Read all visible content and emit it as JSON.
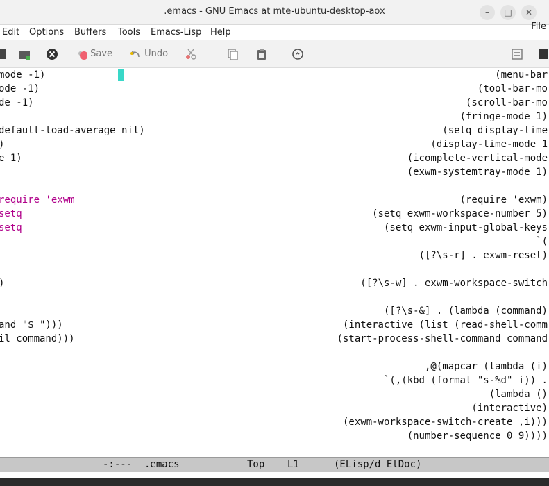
{
  "window": {
    "title": ".emacs - GNU Emacs at mte-ubuntu-desktop-aox",
    "controls": [
      "–",
      "□",
      "✕"
    ]
  },
  "menu": {
    "items": [
      "Edit",
      "Options",
      "Buffers",
      "Tools",
      "Emacs-Lisp",
      "Help"
    ],
    "file": "File"
  },
  "toolbar": {
    "save_label": "Save",
    "undo_label": "Undo"
  },
  "editor": {
    "lines": [
      {
        "left": "mode -1)",
        "right": "(menu-bar"
      },
      {
        "left": "ode -1)",
        "right": "(tool-bar-mo"
      },
      {
        "left": "de -1)",
        "right": "(scroll-bar-mo"
      },
      {
        "left": "",
        "right": "(fringe-mode 1)"
      },
      {
        "left": "default-load-average nil)",
        "right": "(setq display-time"
      },
      {
        "left": ")",
        "right": "(display-time-mode 1"
      },
      {
        "left": "e 1)",
        "right": "(icomplete-vertical-mode"
      },
      {
        "left": "",
        "right": "(exwm-systemtray-mode 1)"
      },
      {
        "left": "",
        "right": ""
      },
      {
        "left": "require 'exwm",
        "right": "(require 'exwm)"
      },
      {
        "left": "setq",
        "right": "(setq exwm-workspace-number 5)"
      },
      {
        "left": "setq",
        "right": "(setq exwm-input-global-keys"
      },
      {
        "left": "",
        "right": "`("
      },
      {
        "left": "",
        "right": "([?\\s-r] . exwm-reset)"
      },
      {
        "left": "",
        "right": ""
      },
      {
        "left": ")",
        "right": "([?\\s-w] . exwm-workspace-switch"
      },
      {
        "left": "",
        "right": ""
      },
      {
        "left": "",
        "right": "([?\\s-&] . (lambda (command)"
      },
      {
        "left": "and \"$ \")))",
        "right": "(interactive (list (read-shell-comm"
      },
      {
        "left": "il command)))",
        "right": "(start-process-shell-command command"
      },
      {
        "left": "",
        "right": ""
      },
      {
        "left": "",
        "right": ",@(mapcar (lambda (i)"
      },
      {
        "left": "",
        "right": "`(,(kbd (format \"s-%d\" i)) ."
      },
      {
        "left": "",
        "right": "(lambda ()"
      },
      {
        "left": "",
        "right": "(interactive)"
      },
      {
        "left": "",
        "right": "(exwm-workspace-switch-create ,i)))"
      },
      {
        "left": "",
        "right": "(number-sequence 0 9))))"
      }
    ]
  },
  "modeline": {
    "status": "-:---",
    "buffer": ".emacs",
    "position": "Top",
    "line": "L1",
    "mode": "(ELisp/d ElDoc)"
  },
  "colors": {
    "keyword": "#b0008a",
    "cursor": "#39d8c8",
    "modeline_bg": "#c7c7c7"
  }
}
